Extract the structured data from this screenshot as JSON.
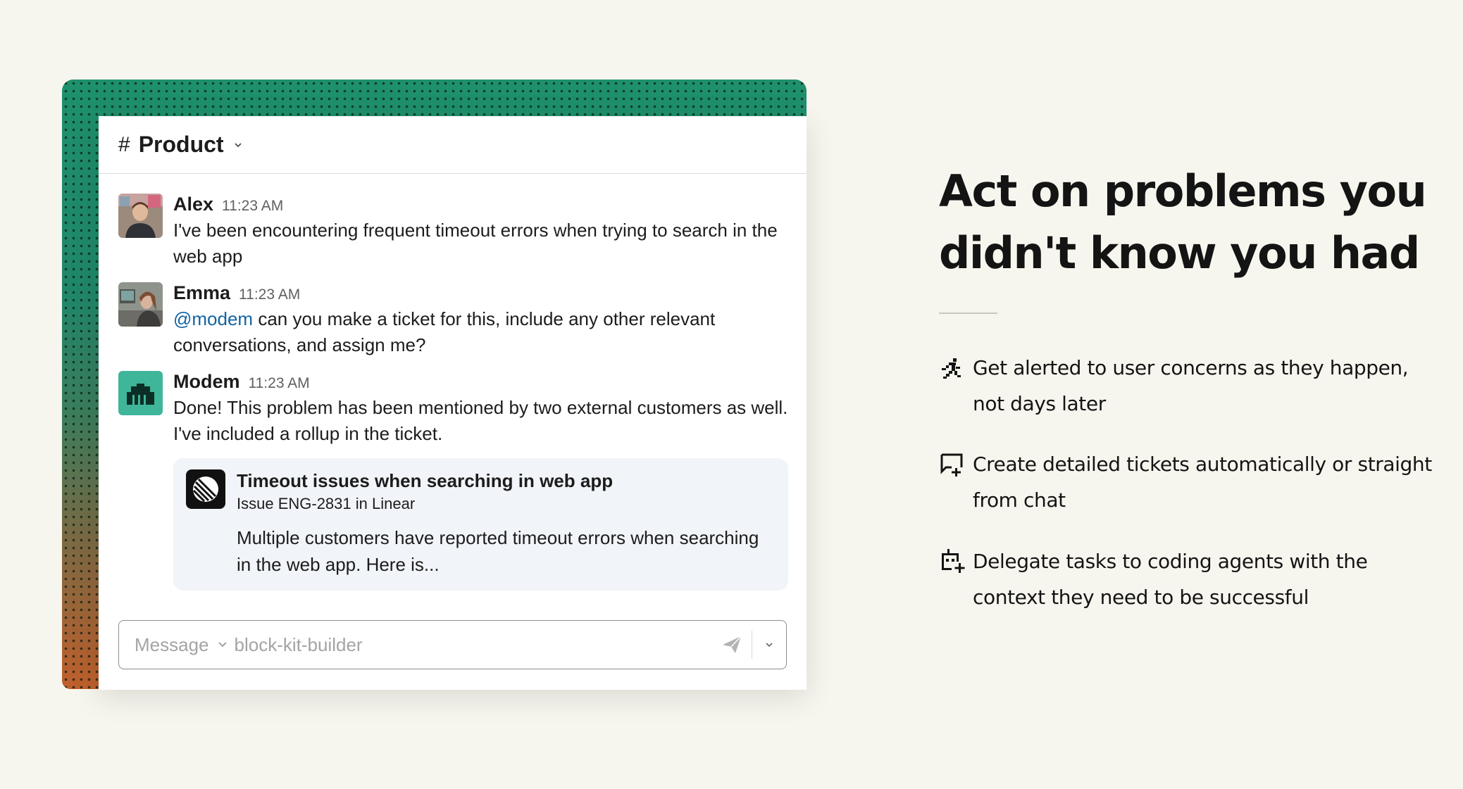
{
  "chat": {
    "channel_hash": "#",
    "channel_name": "Product",
    "messages": [
      {
        "author": "Alex",
        "time": "11:23 AM",
        "text": "I've been encountering frequent timeout errors when trying to search in the web app"
      },
      {
        "author": "Emma",
        "time": "11:23 AM",
        "mention": "@modem",
        "text": " can you make a ticket for this, include any other relevant conversations, and assign me?"
      },
      {
        "author": "Modem",
        "time": "11:23 AM",
        "text": "Done! This problem has been mentioned by two external customers as well. I've included a rollup in the ticket."
      }
    ],
    "attachment": {
      "title": "Timeout issues when searching in web app",
      "subtitle": "Issue ENG-2831 in Linear",
      "description": "Multiple customers have reported timeout errors when searching in the web app. Here is..."
    },
    "composer": {
      "placeholder": "Message",
      "channel": "block-kit-builder"
    }
  },
  "hero": {
    "headline": "Act on problems you didn't know you had",
    "features": [
      {
        "icon": "running-person-icon",
        "text": "Get alerted to user concerns as they happen, not days later"
      },
      {
        "icon": "ticket-chat-icon",
        "text": "Create detailed tickets automatically or straight from chat"
      },
      {
        "icon": "robot-task-icon",
        "text": "Delegate tasks to coding agents with the context they need to be successful"
      }
    ]
  },
  "colors": {
    "background": "#f7f6ee",
    "frame_green": "#1f8f6c",
    "frame_orange": "#c05f2c",
    "mention": "#1264a3",
    "modem_avatar": "#3fb59a"
  }
}
